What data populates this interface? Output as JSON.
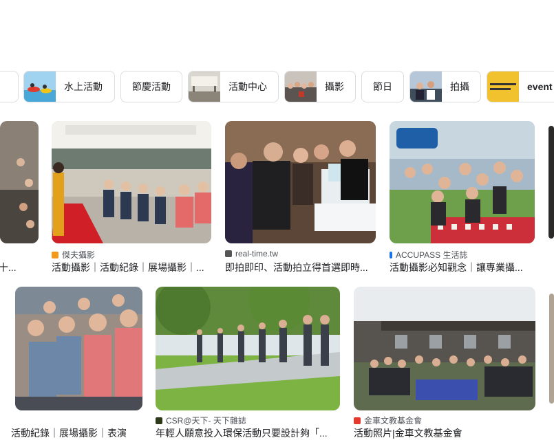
{
  "chips": [
    {
      "label": ""
    },
    {
      "label": "水上活動",
      "icon": "water-activity-thumb"
    },
    {
      "label": "節慶活動"
    },
    {
      "label": "活動中心",
      "icon": "activity-center-thumb"
    },
    {
      "label": "攝影",
      "icon": "photography-thumb"
    },
    {
      "label": "節日"
    },
    {
      "label": "拍攝",
      "icon": "shooting-thumb"
    },
    {
      "label": "event",
      "icon": "event-thumb"
    }
  ],
  "results": [
    {
      "source": "",
      "title": "十..."
    },
    {
      "source": "傑夫攝影",
      "title": "活動攝影｜活動紀錄｜展場攝影｜..."
    },
    {
      "source": "real-time.tw",
      "title": "即拍即印、活動拍立得首選即時..."
    },
    {
      "source": "ACCUPASS 生活誌",
      "title": "活動攝影必知觀念｜讓專業攝..."
    },
    {
      "source": "",
      "title": "活動紀錄｜展場攝影｜表演"
    },
    {
      "source": "CSR@天下- 天下雜誌",
      "title": "年輕人願意投入環保活動只要設計夠「..."
    },
    {
      "source": "金車文教基金會",
      "title": "活動照片|金車文教基金會"
    }
  ],
  "colors": {
    "chip_border": "#dadce0",
    "text_primary": "#202124",
    "text_secondary": "#4d5156"
  }
}
